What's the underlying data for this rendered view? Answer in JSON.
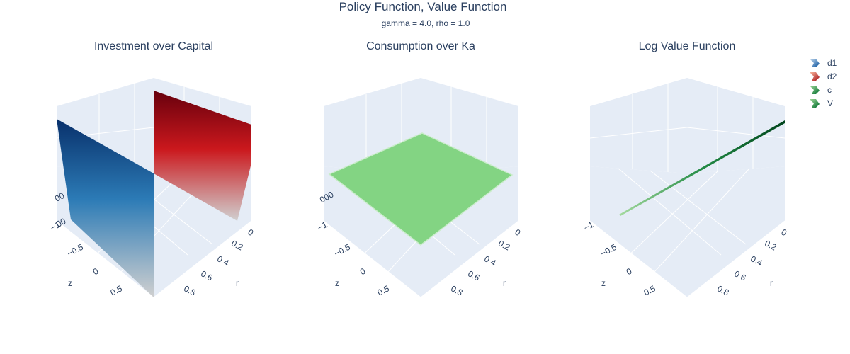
{
  "figure": {
    "title": "Policy Function, Value Function",
    "subtitle": "gamma = 4.0, rho = 1.0"
  },
  "colors": {
    "blues_dark": "#08306b",
    "blues_mid": "#2c7bb6",
    "reds_dark": "#67000d",
    "reds_mid": "#cb181d",
    "greens_light": "#83d483",
    "greens_dark": "#00441b",
    "low_gray": "#d0d0d0",
    "scene_bg": "#e5ecf6",
    "grid": "#ffffff",
    "text": "#2a3f5f"
  },
  "legend": {
    "position": "top-right",
    "items": [
      {
        "key": "d1",
        "label": "d1",
        "colorscale": "Blues"
      },
      {
        "key": "d2",
        "label": "d2",
        "colorscale": "Reds"
      },
      {
        "key": "c",
        "label": "c",
        "colorscale": "Greens"
      },
      {
        "key": "V",
        "label": "V",
        "colorscale": "Greens"
      }
    ]
  },
  "chart_data": [
    {
      "type": "surface",
      "title": "Investment over Capital",
      "series": [
        {
          "name": "d1",
          "colorscale": "Blues"
        },
        {
          "name": "d2",
          "colorscale": "Reds"
        }
      ],
      "axes": {
        "r": {
          "label": "r",
          "ticks": [
            "0",
            "0.2",
            "0.4",
            "0.6",
            "0.8"
          ]
        },
        "z": {
          "label": "z",
          "ticks": [
            "−1",
            "−0.5",
            "0",
            "0.5"
          ]
        },
        "y": {
          "label": "",
          "ticks": [
            "00",
            "00"
          ]
        }
      }
    },
    {
      "type": "surface",
      "title": "Consumption over Ka",
      "series": [
        {
          "name": "c",
          "colorscale": "Greens"
        }
      ],
      "axes": {
        "r": {
          "label": "r",
          "ticks": [
            "0",
            "0.2",
            "0.4",
            "0.6",
            "0.8"
          ]
        },
        "z": {
          "label": "z",
          "ticks": [
            "−1",
            "−0.5",
            "0",
            "0.5"
          ]
        },
        "y": {
          "label": "",
          "ticks": [
            "000"
          ]
        }
      }
    },
    {
      "type": "surface",
      "title": "Log Value Function",
      "series": [
        {
          "name": "V",
          "colorscale": "Greens"
        }
      ],
      "axes": {
        "r": {
          "label": "r",
          "ticks": [
            "0",
            "0.2",
            "0.4",
            "0.6",
            "0.8"
          ]
        },
        "z": {
          "label": "z",
          "ticks": [
            "−1",
            "−0.5",
            "0",
            "0.5"
          ]
        },
        "y": {
          "label": "",
          "ticks": []
        }
      }
    }
  ]
}
